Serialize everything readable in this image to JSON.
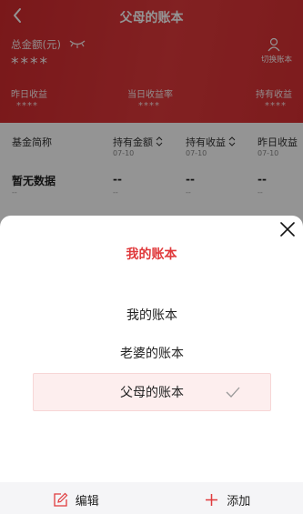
{
  "header": {
    "title": "父母的账本",
    "total_label": "总金额(元)",
    "total_value": "****",
    "switch_label": "切换账本",
    "metrics": [
      {
        "label": "昨日收益",
        "value": "****"
      },
      {
        "label": "当日收益率",
        "value": "****"
      },
      {
        "label": "持有收益",
        "value": "****"
      }
    ]
  },
  "table": {
    "columns": [
      {
        "label": "基金简称",
        "sub": ""
      },
      {
        "label": "持有金额",
        "sub": "07-10"
      },
      {
        "label": "持有收益",
        "sub": "07-10"
      },
      {
        "label": "昨日收益",
        "sub": "07-10"
      }
    ],
    "empty_text": "暂无数据",
    "empty_sub": "--",
    "dash_big": "--",
    "dash_small": "--"
  },
  "sheet": {
    "title": "我的账本",
    "options": [
      {
        "label": "我的账本",
        "selected": false
      },
      {
        "label": "老婆的账本",
        "selected": false
      },
      {
        "label": "父母的账本",
        "selected": true
      }
    ],
    "footer": {
      "edit_label": "编辑",
      "add_label": "添加"
    }
  },
  "colors": {
    "brand": "#e03a3c",
    "selected_bg": "#fdeeee"
  }
}
